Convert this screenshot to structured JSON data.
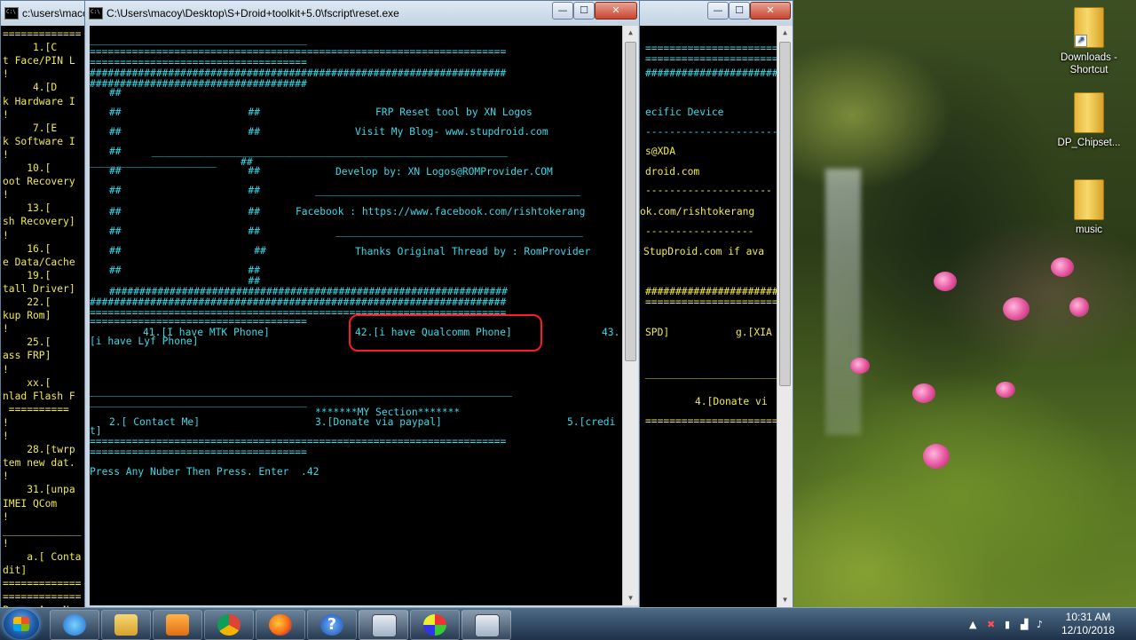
{
  "colors": {
    "console_cyan": "#3ad9e8",
    "console_yellow": "#f0ea4a",
    "highlight": "#ff1a2a"
  },
  "back_window": {
    "title": "c:\\users\\macoy",
    "left_lines": [
      "=============",
      "     1.[C",
      "t Face/PIN L",
      "!",
      "     4.[D",
      "k Hardware I",
      "!",
      "     7.[E",
      "k Software I",
      "!",
      "    10.[",
      "oot Recovery",
      "!",
      "    13.[",
      "sh Recovery]",
      "!",
      "    16.[",
      "e Data/Cache",
      "    19.[",
      "tall Driver]",
      "    22.[",
      "kup Rom]",
      "!",
      "    25.[",
      "ass FRP]",
      "!",
      "    xx.[",
      "nlad Flash F",
      " ==========",
      "!",
      "!",
      "    28.[twrp",
      "tem new dat.",
      "!",
      "    31.[unpa",
      "IMEI QCom",
      "!",
      "_____________",
      "!",
      "    a.[ Conta",
      "dit]",
      "=============",
      "=============",
      "Press Any Nu"
    ],
    "right_fragments": {
      "specific_device": "ecific Device",
      "xda": "s@XDA",
      "droid": "droid.com",
      "fb": "ok.com/rishtokerang",
      "stupdroid": "StupDroid.com if ava",
      "spd": "SPD]",
      "xia": "g.[XIA",
      "donate": "4.[Donate vi"
    }
  },
  "main_window": {
    "title": "C:\\Users\\macoy\\Desktop\\S+Droid+toolkit+5.0\\fscript\\reset.exe",
    "banner_lines": {
      "frp": "FRP Reset tool by XN Logos",
      "blog": "Visit My Blog- www.stupdroid.com",
      "develop": "Develop by: XN Logos@ROMProvider.COM",
      "facebook": "Facebook : https://www.facebook.com/rishtokerang",
      "thanks": "Thanks Original Thread by : RomProvider"
    },
    "options": {
      "opt41": "41.[I have MTK Phone]",
      "opt42": "42.[i have Qualcomm Phone]",
      "opt43": "43.",
      "lyf": "[i have Lyf Phone]"
    },
    "my_section": {
      "header": "*******MY Section*******",
      "contact": "2.[ Contact Me]",
      "donate": "3.[Donate via paypal]",
      "credit_a": "5.[credi",
      "credit_b": "t]"
    },
    "prompt": "Press Any Nuber Then Press. Enter  .42"
  },
  "desktop_icons": [
    {
      "label1": "Downloads -",
      "label2": "Shortcut"
    },
    {
      "label1": "DP_Chipset...",
      "label2": ""
    },
    {
      "label1": "music",
      "label2": ""
    }
  ],
  "taskbar": {
    "apps": [
      "windows-explorer",
      "media-player",
      "chrome",
      "firefox",
      "help",
      "cmd-window",
      "paint",
      "cmd-window-2"
    ],
    "time": "10:31 AM",
    "date": "12/10/2018"
  }
}
